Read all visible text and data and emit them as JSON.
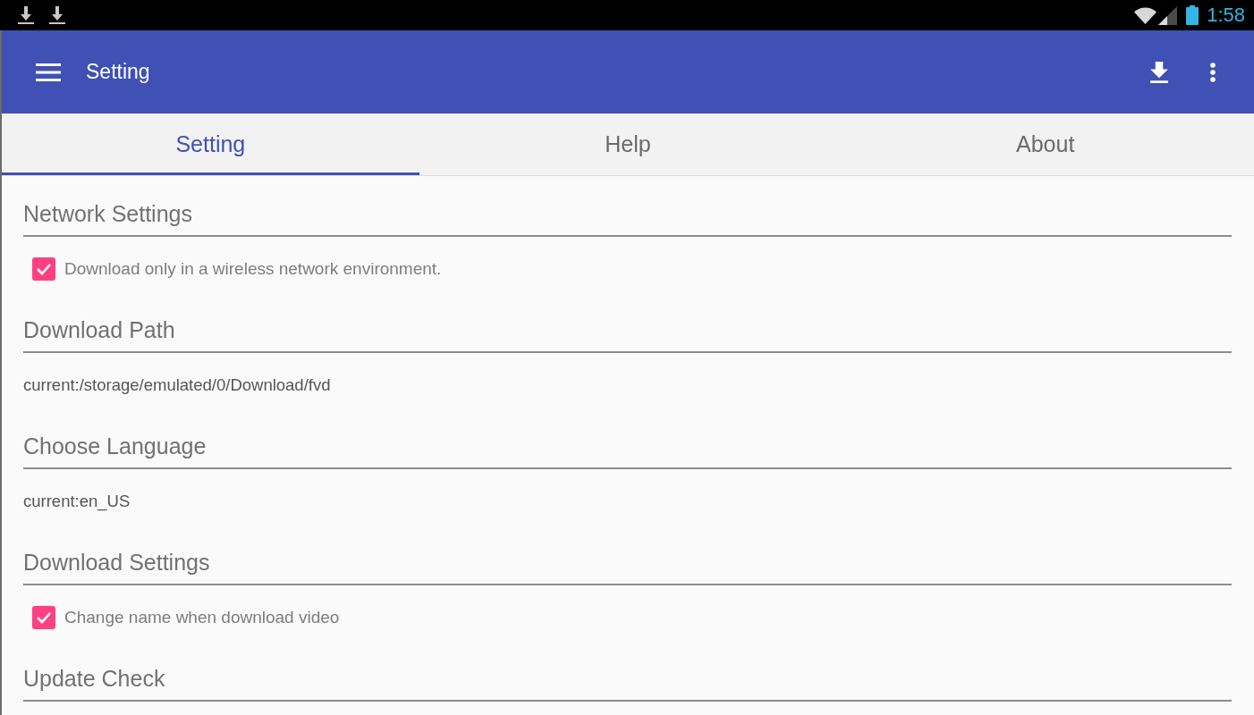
{
  "status_bar": {
    "time": "1:58"
  },
  "app_bar": {
    "title": "Setting"
  },
  "tabs": [
    {
      "label": "Setting",
      "selected": true
    },
    {
      "label": "Help",
      "selected": false
    },
    {
      "label": "About",
      "selected": false
    }
  ],
  "sections": [
    {
      "title": "Network Settings",
      "items": [
        {
          "kind": "checkbox",
          "label": "Download only in a wireless network environment.",
          "checked": true
        }
      ]
    },
    {
      "title": "Download Path",
      "items": [
        {
          "kind": "text",
          "text": "current:/storage/emulated/0/Download/fvd"
        }
      ]
    },
    {
      "title": "Choose Language",
      "items": [
        {
          "kind": "text",
          "text": "current:en_US"
        }
      ]
    },
    {
      "title": "Download Settings",
      "items": [
        {
          "kind": "checkbox",
          "label": "Change name when download video",
          "checked": true
        }
      ]
    },
    {
      "title": "Update Check"
    }
  ]
}
